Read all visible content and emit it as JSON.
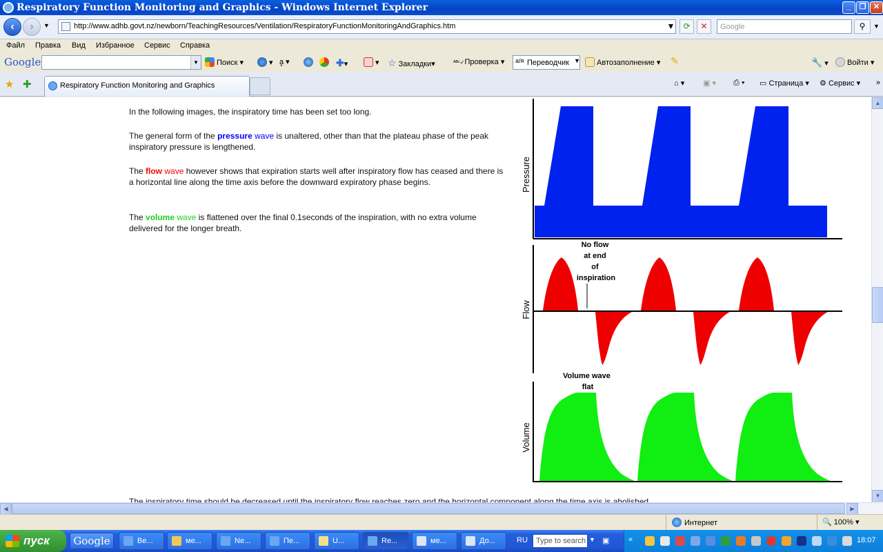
{
  "window": {
    "title": "Respiratory Function Monitoring and Graphics - Windows Internet Explorer"
  },
  "address": {
    "url": "http://www.adhb.govt.nz/newborn/TeachingResources/Ventilation/RespiratoryFunctionMonitoringAndGraphics.htm",
    "search_placeholder": "Google"
  },
  "menu": [
    "Файл",
    "Правка",
    "Вид",
    "Избранное",
    "Сервис",
    "Справка"
  ],
  "google_toolbar": {
    "logo": "Google",
    "search_label": "Поиск",
    "bookmarks": "Закладки",
    "check": "Проверка",
    "translator": "Переводчик",
    "autofill": "Автозаполнение",
    "signin": "Войти"
  },
  "tabs": {
    "active_label": "Respiratory Function Monitoring and Graphics",
    "page": "Страница",
    "service": "Сервис"
  },
  "content": {
    "p1": "In the following images, the inspiratory time has been set too long.",
    "p2_a": "The general form of the ",
    "p2_bold": "pressure",
    "p2_wave": " wave",
    "p2_b": " is unaltered, other than that the plateau phase of the peak inspiratory pressure is lengthened.",
    "p3_a": "The ",
    "p3_bold": "flow",
    "p3_wave": " wave",
    "p3_b": " however shows that expiration starts well after inspiratory flow has ceased and there is a horizontal line along the time axis before the downward expiratory phase begins.",
    "p4_a": "The ",
    "p4_bold": "volume",
    "p4_wave": " wave",
    "p4_b": " is flattened over the final 0.1seconds of the inspiration, with no extra volume delivered for the longer breath.",
    "cut_line": "The inspiratory time should be decreased until the inspiratory flow reaches zero and the horizontal component along the time axis is abolished."
  },
  "graphics": {
    "pressure_label": "Pressure",
    "flow_label": "Flow",
    "volume_label": "Volume",
    "flow_note": [
      "No flow",
      "at end",
      "of",
      "inspiration"
    ],
    "volume_note": [
      "Volume wave",
      "flat"
    ],
    "colors": {
      "pressure": "#0022EE",
      "flow": "#EE0000",
      "volume": "#11EE11"
    }
  },
  "status": {
    "zone": "Интернет",
    "zoom": "100%"
  },
  "taskbar": {
    "start": "пуск",
    "google": "Google",
    "buttons": [
      "Ве...",
      "ме...",
      "Ne...",
      "Пе...",
      "U...",
      "Re...",
      "ме...",
      "До..."
    ],
    "lang": "RU",
    "search_placeholder": "Type to search",
    "clock": "18:07"
  }
}
